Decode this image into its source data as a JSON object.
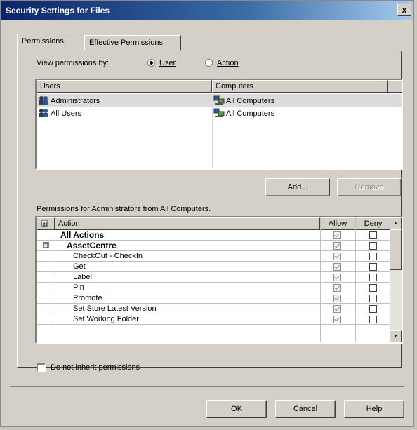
{
  "window": {
    "title": "Security Settings for Files",
    "close_label": "x"
  },
  "tabs": [
    {
      "label": "Permissions"
    },
    {
      "label": "Effective Permissions"
    }
  ],
  "view_by": {
    "label": "View permissions by:",
    "options": [
      {
        "label": "User",
        "selected": true
      },
      {
        "label": "Action",
        "selected": false
      }
    ]
  },
  "users_list": {
    "columns": [
      "Users",
      "Computers"
    ],
    "rows": [
      {
        "user": "Administrators",
        "computer": "All Computers",
        "selected": true
      },
      {
        "user": "All Users",
        "computer": "All Computers",
        "selected": false
      }
    ]
  },
  "buttons": {
    "add": "Add...",
    "remove": "Remove",
    "ok": "OK",
    "cancel": "Cancel",
    "help": "Help"
  },
  "permissions": {
    "label": "Permissions for Administrators from All Computers.",
    "columns": [
      "Action",
      "Allow",
      "Deny"
    ],
    "rows": [
      {
        "action": "All Actions",
        "level": 0,
        "bold": true,
        "expander": "",
        "allow": true,
        "deny": false
      },
      {
        "action": "AssetCentre",
        "level": 1,
        "bold": true,
        "expander": "⊟",
        "allow": true,
        "deny": false
      },
      {
        "action": "CheckOut - CheckIn",
        "level": 2,
        "bold": false,
        "expander": "",
        "allow": true,
        "deny": false
      },
      {
        "action": "Get",
        "level": 2,
        "bold": false,
        "expander": "",
        "allow": true,
        "deny": false
      },
      {
        "action": "Label",
        "level": 2,
        "bold": false,
        "expander": "",
        "allow": true,
        "deny": false
      },
      {
        "action": "Pin",
        "level": 2,
        "bold": false,
        "expander": "",
        "allow": true,
        "deny": false
      },
      {
        "action": "Promote",
        "level": 2,
        "bold": false,
        "expander": "",
        "allow": true,
        "deny": false
      },
      {
        "action": "Set Store Latest Version",
        "level": 2,
        "bold": false,
        "expander": "",
        "allow": true,
        "deny": false
      },
      {
        "action": "Set Working Folder",
        "level": 2,
        "bold": false,
        "expander": "",
        "allow": true,
        "deny": false
      }
    ]
  },
  "inherit": {
    "label": "Do not inherit permissions",
    "checked": false
  },
  "icons": {
    "header_expander": "⊞",
    "scroll_up": "▲",
    "scroll_down": "▼"
  }
}
